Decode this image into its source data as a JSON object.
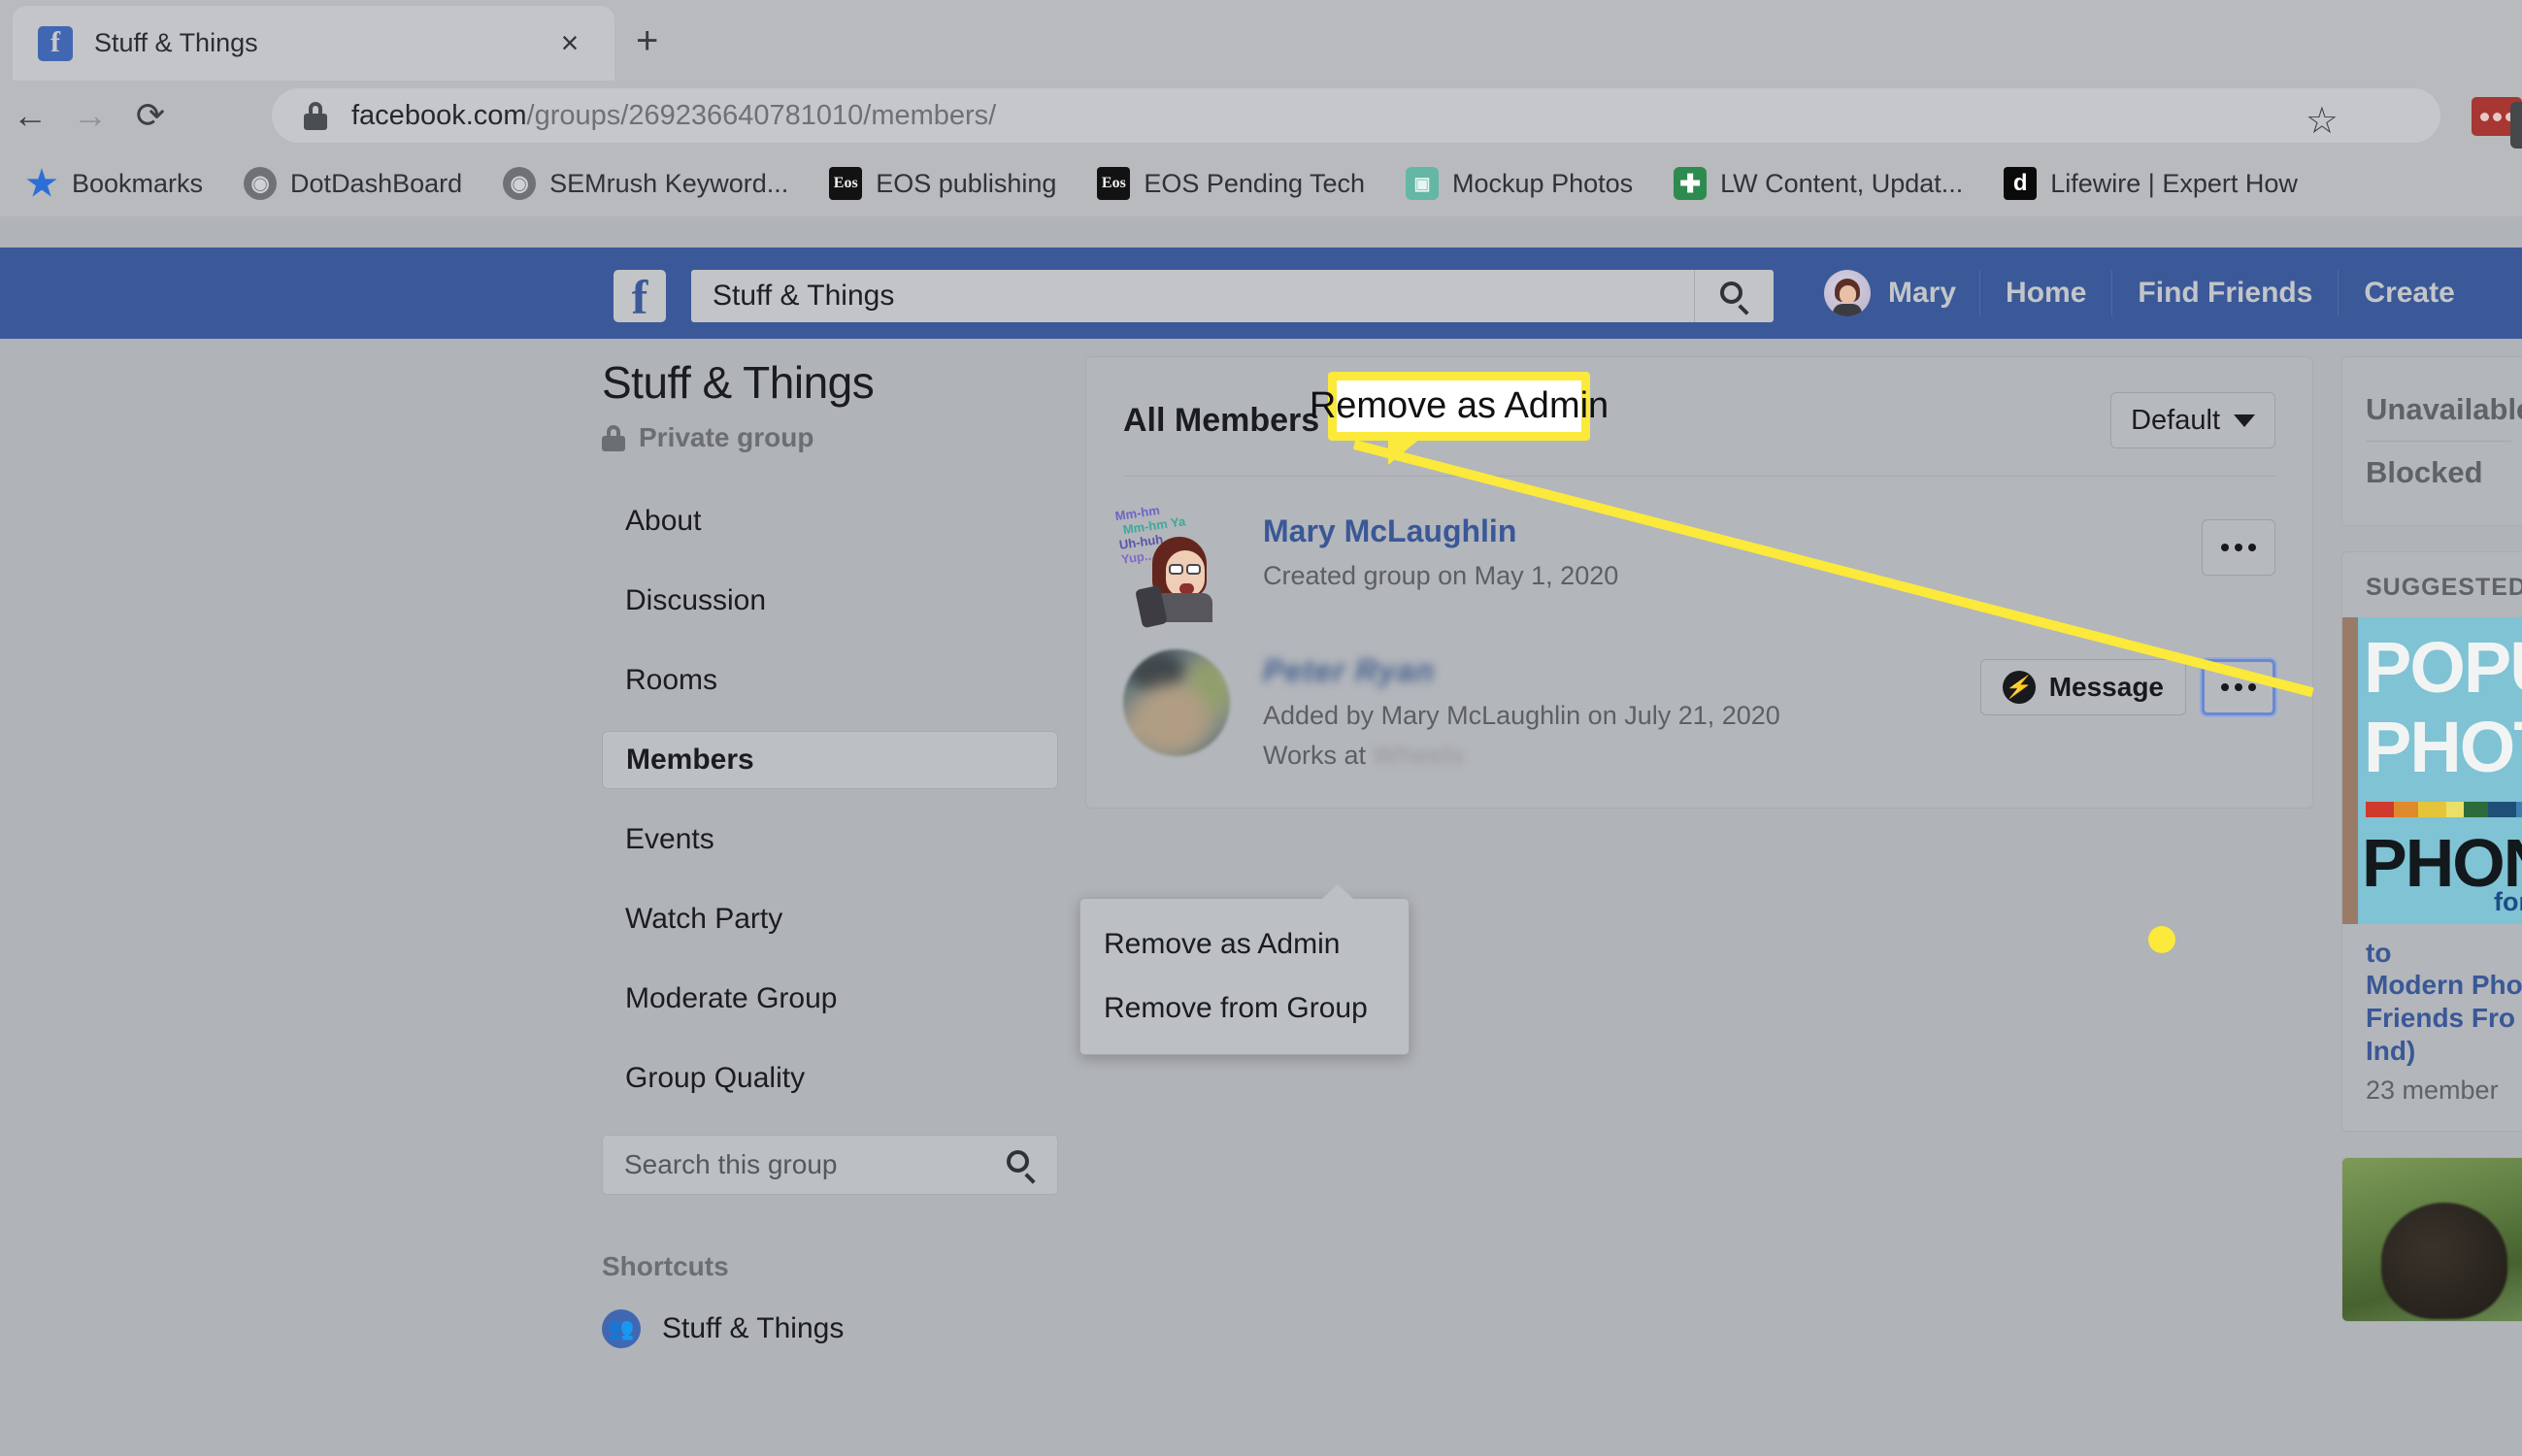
{
  "browser": {
    "tab": {
      "title": "Stuff & Things",
      "favicon": "f",
      "close_label": "×"
    },
    "new_tab_label": "+",
    "nav": {
      "back": "←",
      "forward": "→",
      "reload": "⟳"
    },
    "url": {
      "domain": "facebook.com",
      "path": "/groups/269236640781010/members/"
    },
    "star_label": "☆",
    "bookmarks": [
      {
        "label": "Bookmarks",
        "icon": "star-icon",
        "glyph": "★"
      },
      {
        "label": "DotDashBoard",
        "icon": "globe-icon",
        "glyph": "⊕"
      },
      {
        "label": "SEMrush Keyword...",
        "icon": "globe-icon",
        "glyph": "⊕"
      },
      {
        "label": "EOS publishing",
        "icon": "eos-icon",
        "glyph": "Eos"
      },
      {
        "label": "EOS Pending Tech",
        "icon": "eos-icon",
        "glyph": "Eos"
      },
      {
        "label": "Mockup Photos",
        "icon": "mockup-icon",
        "glyph": "▣"
      },
      {
        "label": "LW Content, Updat...",
        "icon": "lw-cross-icon",
        "glyph": "✚"
      },
      {
        "label": "Lifewire | Expert How",
        "icon": "dotdash-icon",
        "glyph": "d"
      }
    ]
  },
  "fb_header": {
    "logo": "f",
    "search_value": "Stuff & Things",
    "search_icon": "search-icon",
    "user_name": "Mary",
    "links": [
      "Home",
      "Find Friends",
      "Create"
    ]
  },
  "sidebar": {
    "group_title": "Stuff & Things",
    "privacy_label": "Private group",
    "privacy_icon": "lock-icon",
    "nav_items": [
      {
        "label": "About",
        "active": false
      },
      {
        "label": "Discussion",
        "active": false
      },
      {
        "label": "Rooms",
        "active": false
      },
      {
        "label": "Members",
        "active": true
      },
      {
        "label": "Events",
        "active": false
      },
      {
        "label": "Watch Party",
        "active": false
      },
      {
        "label": "Moderate Group",
        "active": false
      },
      {
        "label": "Group Quality",
        "active": false
      }
    ],
    "search_placeholder": "Search this group",
    "shortcuts_heading": "Shortcuts",
    "shortcuts": [
      {
        "label": "Stuff & Things",
        "icon": "group-icon"
      }
    ]
  },
  "main": {
    "section_title": "All Members",
    "sort_button": "Default",
    "members": [
      {
        "name": "Mary McLaughlin",
        "meta": "Created group on May 1, 2020",
        "works_at": null,
        "has_message_button": false,
        "more_button": "•••",
        "avatar": "bitmoji-avatar",
        "bubbles": [
          "Mm-hm",
          "Mm-hm Ya",
          "Uh-huh.",
          "Yup..."
        ]
      },
      {
        "name": "Peter Ryan",
        "name_blurred": true,
        "meta": "Added by Mary McLaughlin on July 21, 2020",
        "works_at_prefix": "Works at ",
        "works_at": "Wheels",
        "works_at_blurred": true,
        "message_button": "Message",
        "message_icon": "messenger-icon",
        "has_message_button": true,
        "more_button": "•••",
        "avatar": "photo-avatar"
      }
    ]
  },
  "dropdown": {
    "items": [
      "Remove as Admin",
      "Remove from Group"
    ]
  },
  "callout": {
    "text": "Remove as Admin",
    "highlight_color": "#fbe93b"
  },
  "right_sidebar": {
    "links": [
      "Unavailable",
      "Blocked"
    ],
    "suggested_heading": "SUGGESTED",
    "suggested_card": {
      "cover_text_lines": [
        "POPU",
        "PHOT",
        "PHON"
      ],
      "cover_footer": "for",
      "link_line_0": "to",
      "link_line_1": "Modern Pho",
      "link_line_2": "Friends Fro",
      "link_line_3": "Ind)",
      "member_count": "23 member"
    }
  },
  "colors": {
    "fb_blue": "#3b5998",
    "page_overlay": "#b0b3b8",
    "highlight_yellow": "#fbe93b",
    "link_blue": "#3a5897"
  }
}
